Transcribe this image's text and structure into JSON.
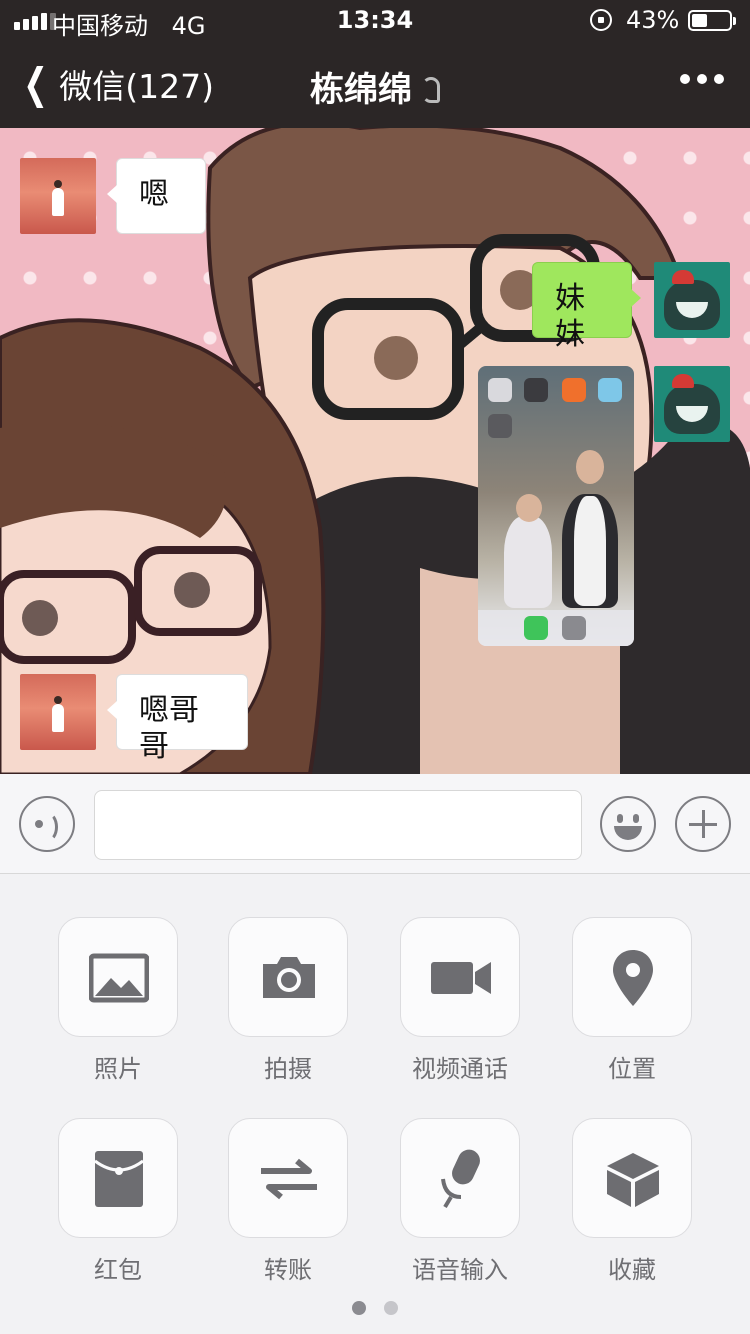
{
  "status_bar": {
    "carrier": "中国移动",
    "network": "4G",
    "time": "13:34",
    "battery_percent": "43%",
    "battery_level": 0.43
  },
  "nav": {
    "back_label": "微信(127)",
    "title": "栋绵绵",
    "icons": [
      "chevron-left-icon",
      "ear-icon",
      "more-icon"
    ]
  },
  "messages": [
    {
      "side": "left",
      "text": "嗯"
    },
    {
      "side": "right",
      "text": "妹妹"
    },
    {
      "side": "right",
      "type": "image"
    },
    {
      "side": "left",
      "text": "嗯哥哥"
    }
  ],
  "input_bar": {
    "value": "",
    "icons": [
      "voice-icon",
      "emoji-icon",
      "plus-icon"
    ]
  },
  "functions": [
    {
      "label": "照片",
      "icon": "photo-icon"
    },
    {
      "label": "拍摄",
      "icon": "camera-icon"
    },
    {
      "label": "视频通话",
      "icon": "video-call-icon"
    },
    {
      "label": "位置",
      "icon": "location-icon"
    },
    {
      "label": "红包",
      "icon": "red-packet-icon"
    },
    {
      "label": "转账",
      "icon": "transfer-icon"
    },
    {
      "label": "语音输入",
      "icon": "microphone-icon"
    },
    {
      "label": "收藏",
      "icon": "favorites-icon"
    }
  ],
  "page_indicator": {
    "pages": 2,
    "current": 1
  },
  "colors": {
    "nav_bg": "#2b2626",
    "bubble_mine": "#9fe75d",
    "bubble_theirs": "#ffffff",
    "chat_bg": "#f1b9c3",
    "panel_icon": "#6d6d71"
  }
}
